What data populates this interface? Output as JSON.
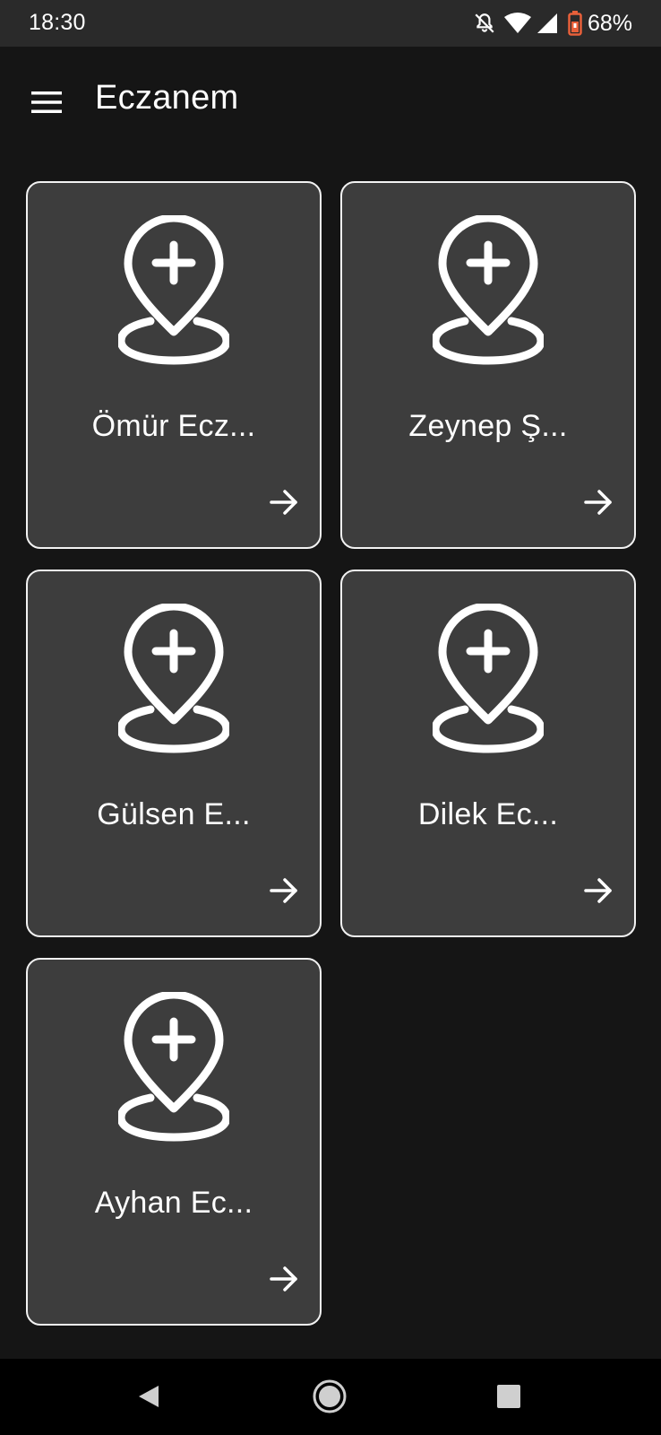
{
  "status_bar": {
    "time": "18:30",
    "battery_percent": "68%",
    "icons": [
      "notifications-off-icon",
      "wifi-icon",
      "signal-icon",
      "battery-icon"
    ]
  },
  "app_bar": {
    "title": "Eczanem",
    "menu_icon": "menu-icon"
  },
  "pharmacies": [
    {
      "name": "Ömür Ecz...",
      "icon": "pharmacy-location-icon",
      "action_icon": "arrow-right-icon"
    },
    {
      "name": "Zeynep Ş...",
      "icon": "pharmacy-location-icon",
      "action_icon": "arrow-right-icon"
    },
    {
      "name": "Gülsen E...",
      "icon": "pharmacy-location-icon",
      "action_icon": "arrow-right-icon"
    },
    {
      "name": "Dilek Ec...",
      "icon": "pharmacy-location-icon",
      "action_icon": "arrow-right-icon"
    },
    {
      "name": "Ayhan Ec...",
      "icon": "pharmacy-location-icon",
      "action_icon": "arrow-right-icon"
    }
  ],
  "nav_bar": {
    "buttons": [
      "back-icon",
      "home-icon",
      "recents-icon"
    ]
  },
  "colors": {
    "background": "#151515",
    "status_bar": "#2a2a2a",
    "card_background": "#3d3d3d",
    "card_border": "#f2f2f2",
    "battery_accent": "#e8603a",
    "nav_bar": "#000000"
  }
}
